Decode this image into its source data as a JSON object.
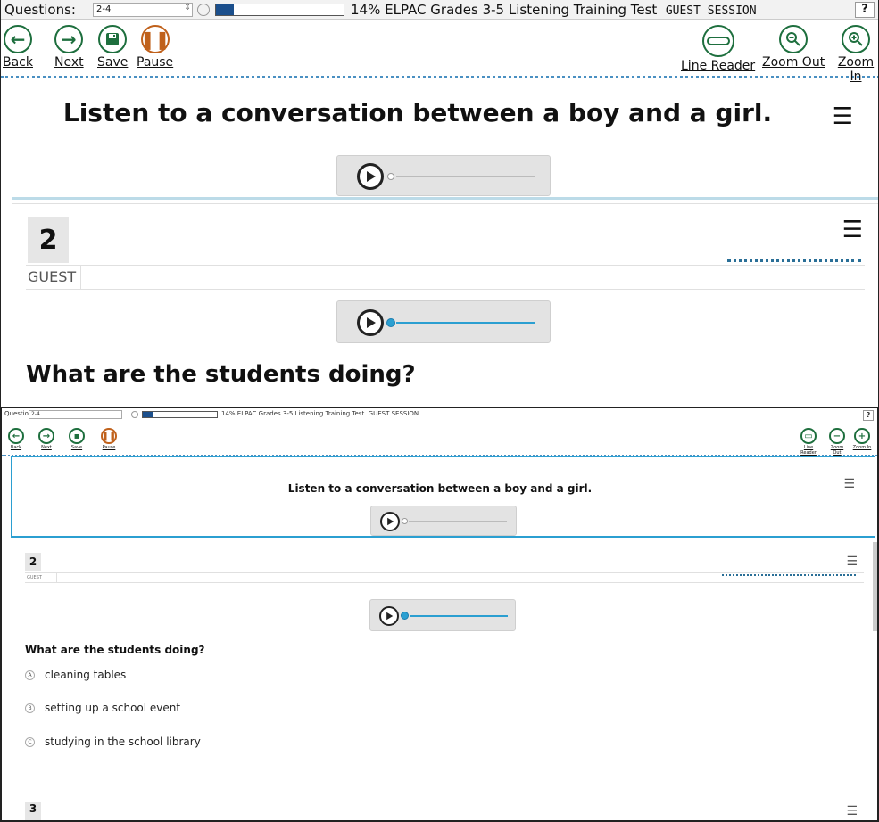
{
  "header": {
    "questions_label": "Questions:",
    "questions_value": "2-4",
    "progress_percent": 14,
    "progress_text": "14%",
    "test_title": "ELPAC Grades 3-5 Listening Training Test",
    "session": "GUEST SESSION",
    "help": "?"
  },
  "toolbar": {
    "back": "Back",
    "next": "Next",
    "save": "Save",
    "pause": "Pause",
    "line_reader": "Line Reader",
    "zoom_out": "Zoom Out",
    "zoom_in": "Zoom In"
  },
  "stimulus": {
    "instruction": "Listen to a conversation between a boy and a girl."
  },
  "item": {
    "number": "2",
    "user": "GUEST",
    "question": "What are the students doing?",
    "options": [
      {
        "letter": "A",
        "text": "cleaning tables"
      },
      {
        "letter": "B",
        "text": "setting up a school event"
      },
      {
        "letter": "C",
        "text": "studying in the school library"
      }
    ],
    "next_number": "3"
  },
  "colors": {
    "accent_blue": "#2b9fd1",
    "progress_fill": "#1b4f8c",
    "tool_green": "#1e6f3e",
    "pause_orange": "#c0611b"
  }
}
